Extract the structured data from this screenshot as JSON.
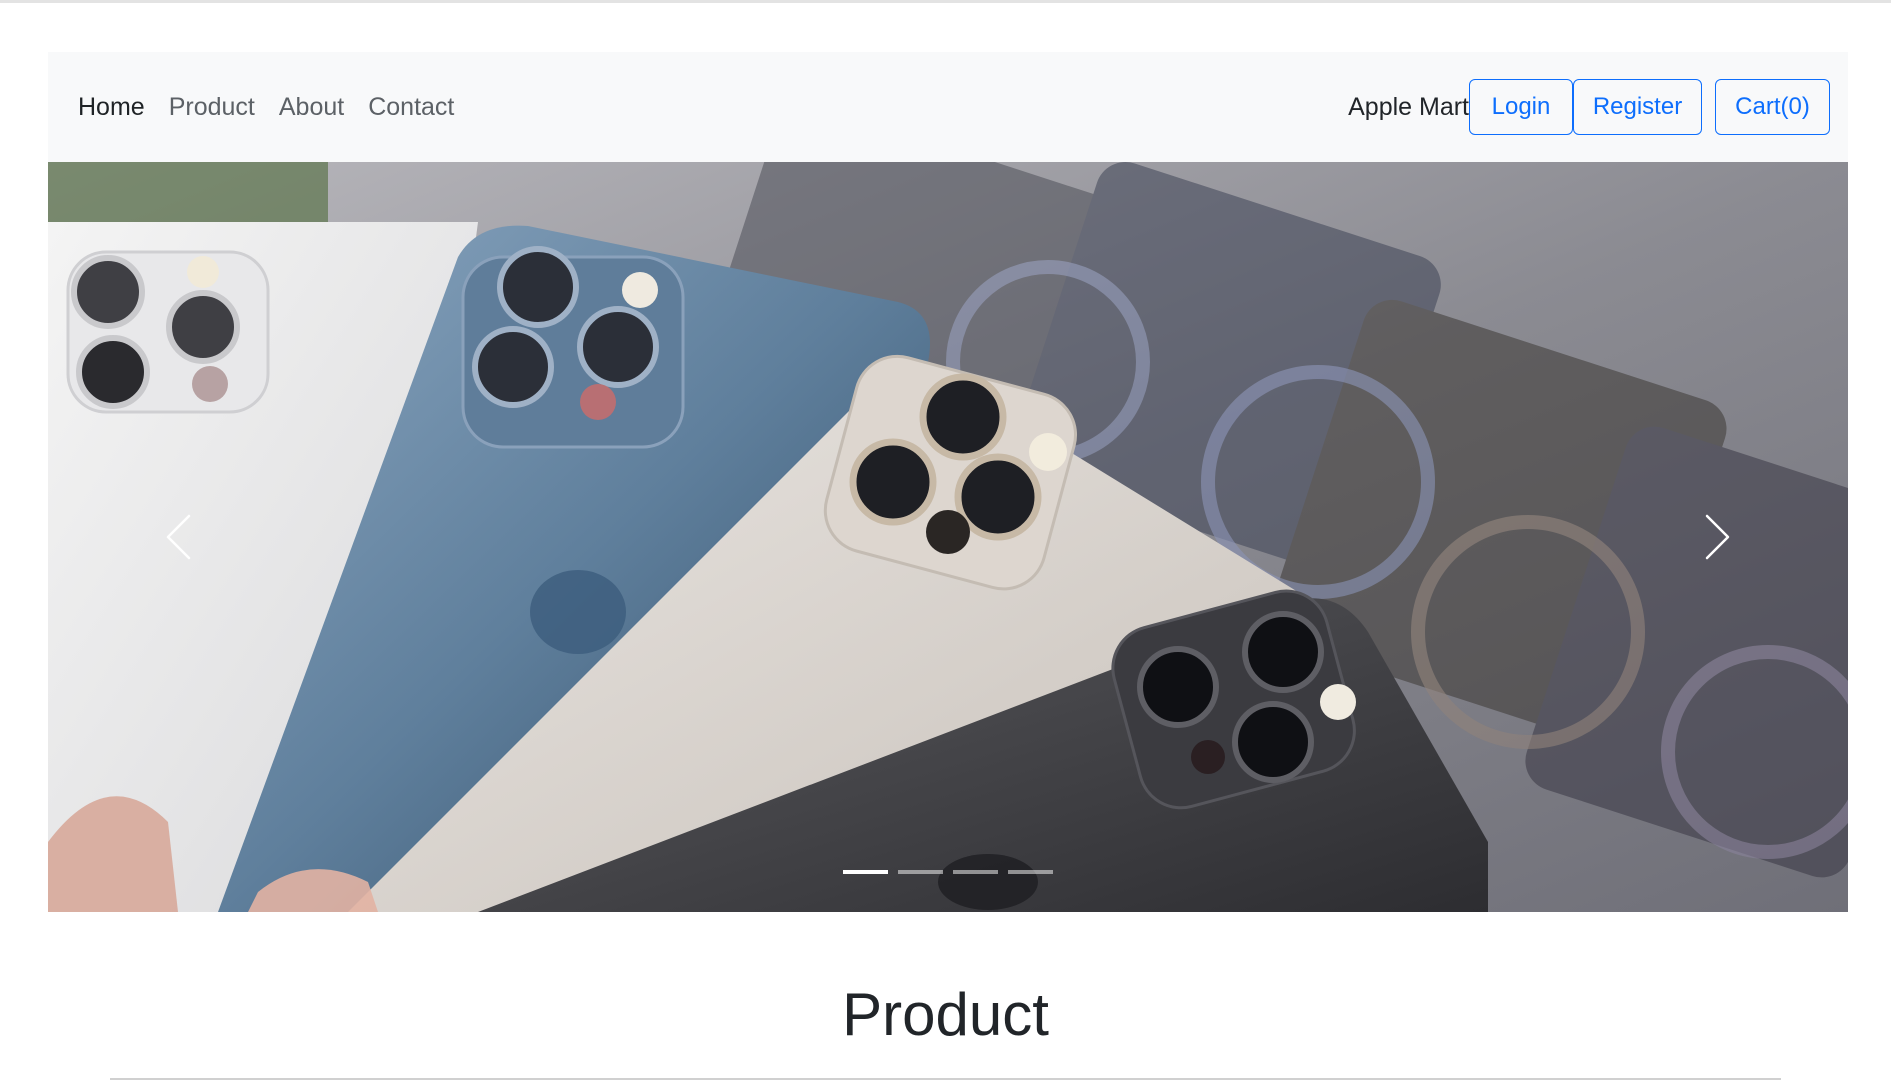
{
  "nav": {
    "links": [
      {
        "label": "Home",
        "active": true
      },
      {
        "label": "Product",
        "active": false
      },
      {
        "label": "About",
        "active": false
      },
      {
        "label": "Contact",
        "active": false
      }
    ],
    "brand": "Apple Mart",
    "login_label": "Login",
    "register_label": "Register",
    "cart_label": "Cart(0)"
  },
  "carousel": {
    "slide_count": 4,
    "active_index": 0,
    "prev_icon": "chevron-left-icon",
    "next_icon": "chevron-right-icon"
  },
  "section": {
    "title": "Product"
  },
  "colors": {
    "accent": "#0d6efd",
    "navbar_bg": "#f8f9fa"
  }
}
